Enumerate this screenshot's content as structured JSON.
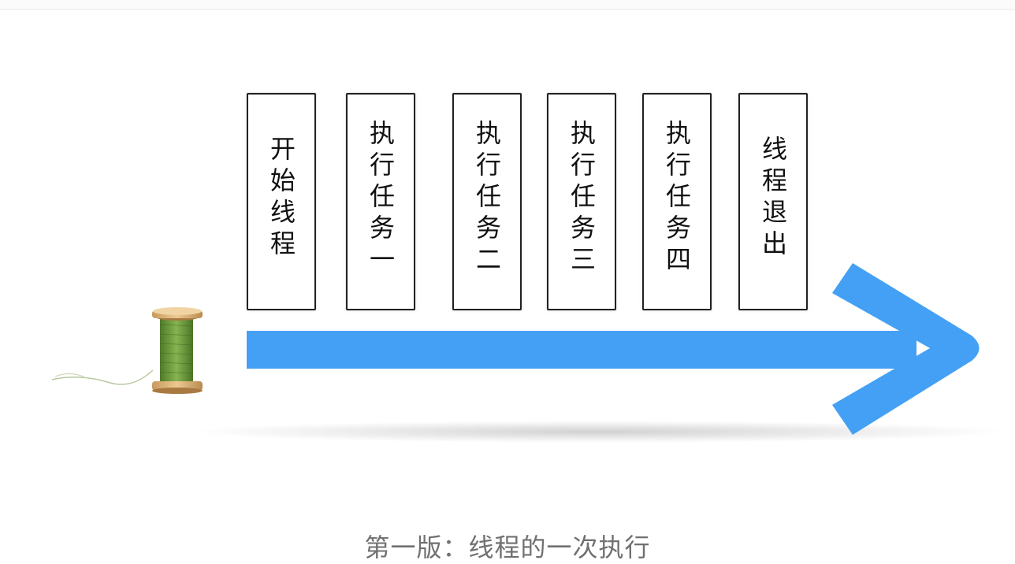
{
  "boxes": [
    {
      "id": "start-thread",
      "label": "开始线程"
    },
    {
      "id": "task-1",
      "label": "执行任务一"
    },
    {
      "id": "task-2",
      "label": "执行任务二"
    },
    {
      "id": "task-3",
      "label": "执行任务三"
    },
    {
      "id": "task-4",
      "label": "执行任务四"
    },
    {
      "id": "thread-exit",
      "label": "线程退出"
    }
  ],
  "caption": "第一版：线程的一次执行",
  "colors": {
    "arrow": "#44a0f4",
    "thread_green": "#6a9a3a",
    "spool_wood": "#d9b27c",
    "box_border": "#222222",
    "caption_text": "#707070"
  },
  "icons": {
    "spool": "thread-spool-icon",
    "arrow": "timeline-arrow-icon"
  }
}
